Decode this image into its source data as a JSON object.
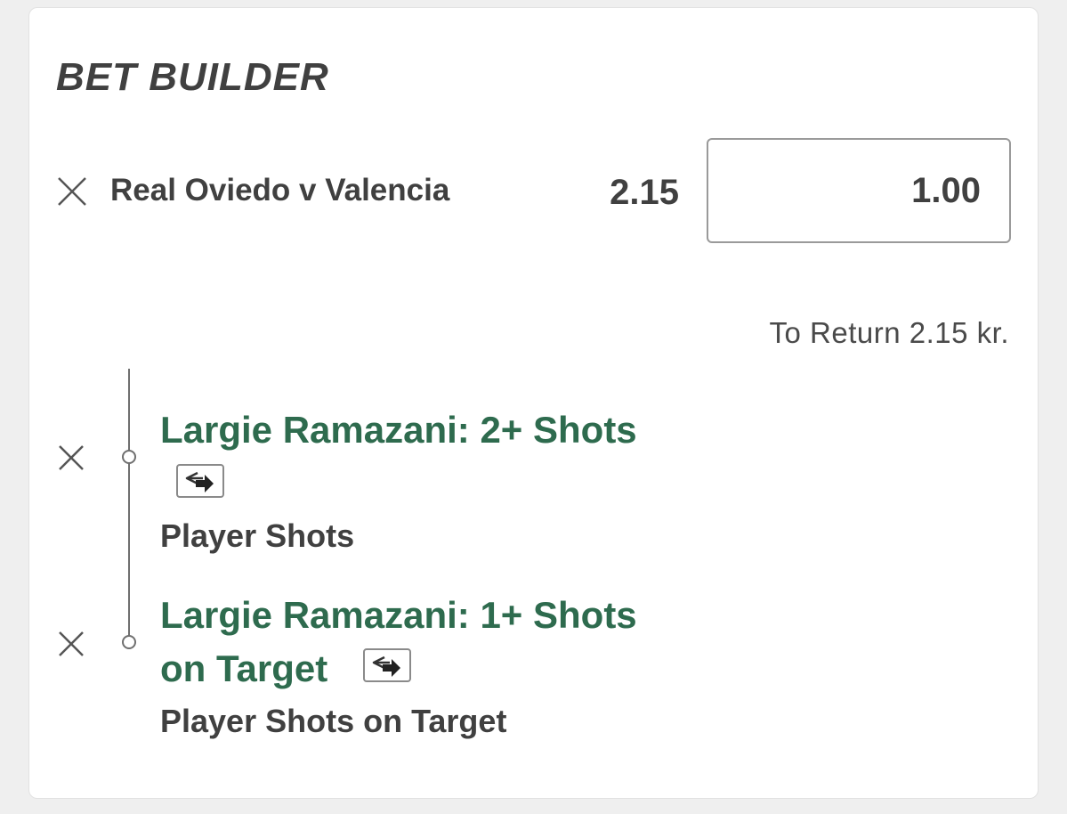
{
  "header": {
    "title": "BET BUILDER"
  },
  "bet": {
    "event": "Real Oviedo v Valencia",
    "odds": "2.15",
    "stake": "1.00",
    "to_return": "To Return 2.15 kr."
  },
  "selections": [
    {
      "title_line1": "Largie Ramazani: 2+ Shots",
      "market": "Player Shots",
      "icon": "swap-arrows-icon"
    },
    {
      "title_line1": "Largie Ramazani: 1+ Shots",
      "title_line2": "on Target",
      "market": "Player Shots on Target",
      "icon": "swap-arrows-icon"
    }
  ],
  "colors": {
    "selection_green": "#2e6b4e",
    "text_dark": "#404040",
    "background": "#efefef"
  }
}
